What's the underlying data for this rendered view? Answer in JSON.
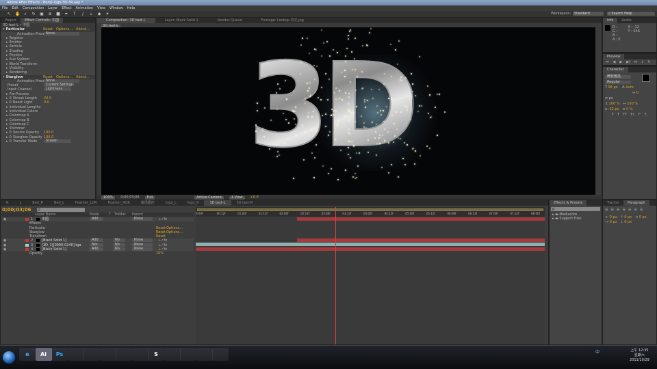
{
  "window": {
    "title": "Adobe After Effects - BenQ-logo-3D-34.aep *"
  },
  "menu": [
    "File",
    "Edit",
    "Composition",
    "Layer",
    "Effect",
    "Animation",
    "View",
    "Window",
    "Help"
  ],
  "workspace": {
    "label": "Workspace:",
    "value": "Standard",
    "search_placeholder": "Search Help"
  },
  "left_panel": {
    "tabs": [
      "Project",
      "Effect Controls: 中国"
    ],
    "header": "3D.text-L • 中国",
    "effects": [
      {
        "name": "Particular",
        "reset": "Reset",
        "options": "Options...",
        "about": "About...",
        "preset_label": "Animation Presets:",
        "preset": "None",
        "groups": [
          "Register",
          "Emitter",
          "Particle",
          "Shading",
          "Physics",
          "Aux System",
          "World Transform",
          "Visibility",
          "Rendering"
        ]
      },
      {
        "name": "Starglow",
        "reset": "Reset",
        "options": "Options...",
        "about": "About...",
        "preset_label": "Animation Presets:",
        "preset": "None",
        "props": [
          {
            "label": "Preset",
            "value": "Current Settings"
          },
          {
            "label": "Input Channel",
            "value": "Lightness"
          },
          {
            "label": "Pre-Process",
            "value": ""
          },
          {
            "label": "Streak Length",
            "value": "20.0"
          },
          {
            "label": "Boost Light",
            "value": "0.0"
          },
          {
            "label": "Individual Lengths",
            "value": ""
          },
          {
            "label": "Individual Colors",
            "value": ""
          },
          {
            "label": "Colormap A",
            "value": ""
          },
          {
            "label": "Colormap B",
            "value": ""
          },
          {
            "label": "Colormap C",
            "value": ""
          },
          {
            "label": "Shimmer",
            "value": ""
          },
          {
            "label": "Source Opacity",
            "value": "100.0"
          },
          {
            "label": "Starglow Opacity",
            "value": "100.0"
          },
          {
            "label": "Transfer Mode",
            "value": "Screen"
          }
        ]
      }
    ]
  },
  "comp": {
    "tabs": [
      "Composition: 3D.text-L",
      "Layer: Black Solid 1",
      "Render Queue",
      "Footage: Lookup 中文.jpg"
    ],
    "subtab": "3D.text-L",
    "logo_text": "3D",
    "footer": {
      "zoom": "100%",
      "timecode": "0;00;03;06",
      "resolution": "Full",
      "camera": "Active Camera",
      "view": "1 View",
      "exposure": "+0.0"
    }
  },
  "info": {
    "tabs": [
      "Info",
      "Audio"
    ],
    "r": "R :",
    "g": "G :",
    "b": "B :",
    "a": "A : 0",
    "x": "X : -12",
    "y": "Y : 546"
  },
  "preview": {
    "tab": "Preview"
  },
  "character": {
    "tab": "Character",
    "font": "微软雅黑",
    "style": "Regular",
    "size": "96 px",
    "tracking": "Auto",
    "leading": "0",
    "unit": "px",
    "vscale": "100 %",
    "hscale": "100 %",
    "baseline": "-32 px",
    "tsume": "0 %",
    "styles": [
      "T",
      "T",
      "TT",
      "Tт",
      "T'",
      "T,"
    ]
  },
  "timeline": {
    "tabs": [
      "R",
      "L",
      "Bed_R",
      "Bed_L",
      "Feather_LOR",
      "Feather_ROR",
      "磁场图形",
      "logo_L",
      "logo_R",
      "3D.text-L",
      "3D.text-R"
    ],
    "active_tab": 9,
    "timecode": "0;00;03;06",
    "columns": [
      "Layer Name",
      "Mode",
      "T",
      "TrkMat",
      "Parent"
    ],
    "ruler": [
      "0:00f",
      "00:12f",
      "01:00f",
      "01:12f",
      "02:00f",
      "02:12f",
      "03:00f",
      "03:12f",
      "04:00f",
      "04:12f",
      "05:00f",
      "05:12f",
      "06:00f",
      "06:12f",
      "07:00f",
      "07:12f",
      "08:00f"
    ],
    "playhead_fraction": 0.4,
    "layers": [
      {
        "num": "1",
        "name": "中国",
        "mode": "Add",
        "trkmat": "",
        "parent": "None",
        "color": "#c0393b",
        "bar": [
          0.29,
          1.0
        ]
      },
      {
        "sub": "Effects"
      },
      {
        "sub": "Particular",
        "reset": "Reset",
        "options": "Options..."
      },
      {
        "sub": "Starglow",
        "reset": "Reset",
        "options": "Options..."
      },
      {
        "sub": "Transform",
        "reset": "Reset"
      },
      {
        "num": "2",
        "name": "[Black Solid 1]",
        "mode": "Add",
        "trkmat": "No",
        "parent": "None",
        "color": "#c0393b",
        "bar": [
          0.29,
          1.0
        ]
      },
      {
        "num": "3",
        "name": "[3D_1][0000-0240].tga",
        "mode": "Nor.",
        "trkmat": "No",
        "parent": "None",
        "color": "#a8d0d0",
        "bar": [
          0,
          1.0
        ]
      },
      {
        "num": "4",
        "name": "[Black Solid 1]",
        "mode": "Add",
        "trkmat": "No",
        "parent": "None",
        "color": "#c0393b",
        "bar": [
          0,
          1.0
        ]
      },
      {
        "sub": "Opacity",
        "value": "10%"
      }
    ]
  },
  "effects_presets": {
    "tab": "Effects & Presets",
    "search": "ρ",
    "items": [
      "Madiacore",
      "Support Files"
    ]
  },
  "paragraph": {
    "tabs": [
      "Tracker",
      "Paragraph"
    ],
    "values": [
      "0 px",
      "0 px",
      "0 px",
      "0 px",
      "0 px"
    ]
  },
  "taskbar": {
    "apps": [
      "e",
      "Ai",
      "Ps",
      "",
      "",
      "",
      "",
      "",
      "S",
      "",
      "",
      "",
      ""
    ],
    "ime": "中",
    "time": "上午 12:35",
    "day": "星期六",
    "date": "2011/10/29"
  }
}
